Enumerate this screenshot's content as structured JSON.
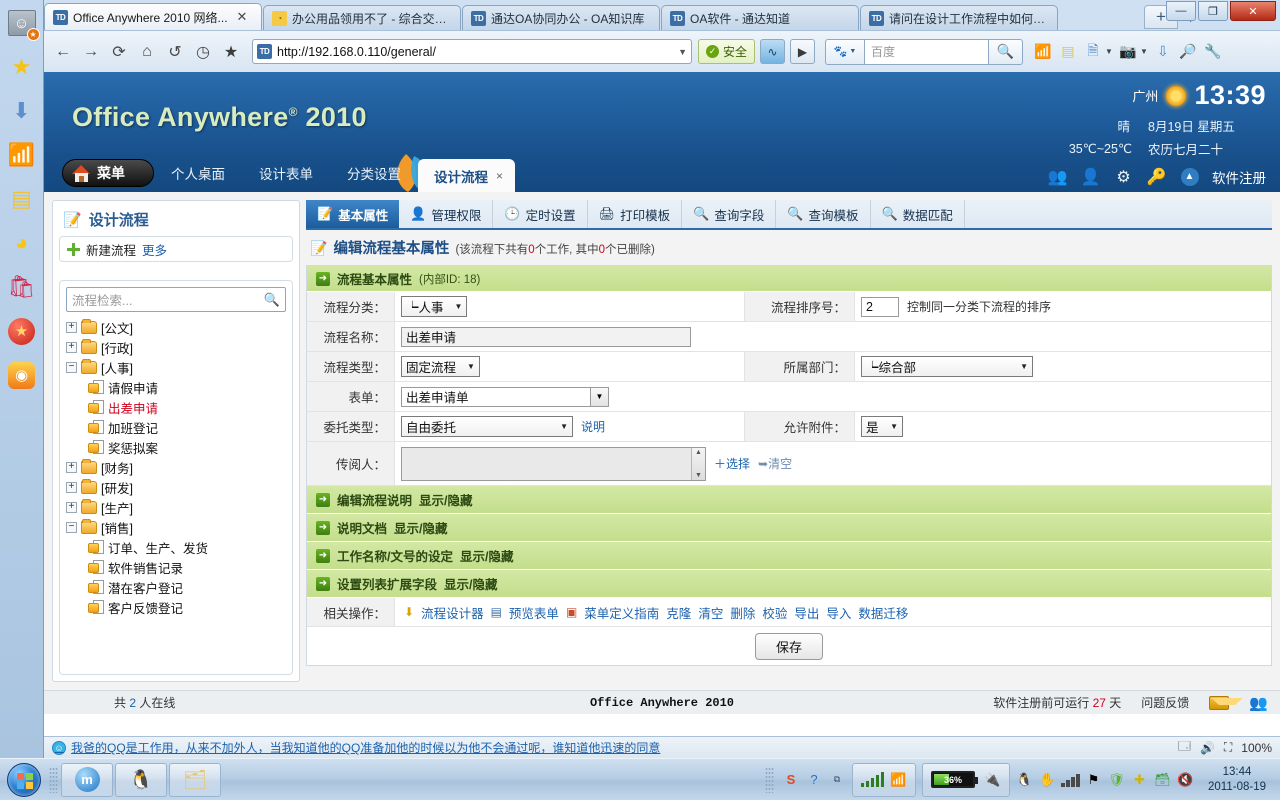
{
  "browser": {
    "tabs": [
      {
        "title": "Office Anywhere 2010 网络...",
        "favicon": "td-icon",
        "active": true,
        "closable": true
      },
      {
        "title": "办公用品领用不了 - 综合交流区...",
        "favicon": "qq-icon",
        "active": false
      },
      {
        "title": "通达OA协同办公 - OA知识库",
        "favicon": "td-icon",
        "active": false
      },
      {
        "title": "OA软件 - 通达知道",
        "favicon": "td-icon",
        "active": false
      },
      {
        "title": "请问在设计工作流程中如何设...",
        "favicon": "td-icon",
        "active": false
      }
    ],
    "newtab_label": "+",
    "window_controls": {
      "minimize": "—",
      "maximize": "❐",
      "close": "✕"
    },
    "nav": {
      "back": "←",
      "forward": "→",
      "reload": "⟳",
      "home": "⌂",
      "undo": "↺",
      "history": "◷",
      "favorite": "★"
    },
    "url": "http://192.168.0.110/general/",
    "url_favicon": "td-icon",
    "secure_label": "安全",
    "search_placeholder": "百度",
    "search_value": "",
    "toolbar_icons": [
      "rss-icon",
      "note-icon",
      "translate-icon",
      "camera-icon",
      "download-icon",
      "screenshot-icon",
      "tools-icon"
    ]
  },
  "rail_icons": [
    "avatar-icon",
    "star-icon",
    "download-arrow-icon",
    "rss-icon",
    "note-icon",
    "pacman-icon",
    "shop-bag-icon",
    "red-star-icon",
    "weibo-icon"
  ],
  "oa": {
    "brand": "Office Anywhere",
    "brand_sup": "®",
    "brand_year": "2010",
    "menu_label": "菜单",
    "nav_tabs": [
      {
        "label": "个人桌面",
        "active": false
      },
      {
        "label": "设计表单",
        "active": false
      },
      {
        "label": "分类设置",
        "active": false
      },
      {
        "label": "设计流程",
        "active": true,
        "close": "×"
      }
    ],
    "header_right": {
      "city": "广州",
      "weather_icon": "sun-icon",
      "clock": "13:39",
      "condition": "晴",
      "date": "8月19日 星期五",
      "temperature": "35℃~25℃",
      "lunar": "农历七月二十",
      "icons": [
        "people-icon",
        "user-edit-icon",
        "gear-icon",
        "key-icon",
        "collapse-icon"
      ],
      "register_link": "软件注册"
    },
    "inline_search_value": ""
  },
  "sidebar": {
    "title": "设计流程",
    "title_icon": "edit-flow-icon",
    "new_flow": "新建流程",
    "more": "更多",
    "search_placeholder": "流程检索...",
    "search_icon": "search-icon",
    "tree": [
      {
        "label": "[公文]",
        "type": "folder",
        "expanded": false,
        "toggle": "+"
      },
      {
        "label": "[行政]",
        "type": "folder",
        "expanded": false,
        "toggle": "+"
      },
      {
        "label": "[人事]",
        "type": "folder",
        "expanded": true,
        "toggle": "−"
      },
      {
        "label": "请假申请",
        "type": "doc",
        "selected": false
      },
      {
        "label": "出差申请",
        "type": "doc",
        "selected": true
      },
      {
        "label": "加班登记",
        "type": "doc",
        "selected": false
      },
      {
        "label": "奖惩拟案",
        "type": "doc",
        "selected": false
      },
      {
        "label": "[财务]",
        "type": "folder",
        "expanded": false,
        "toggle": "+"
      },
      {
        "label": "[研发]",
        "type": "folder",
        "expanded": false,
        "toggle": "+"
      },
      {
        "label": "[生产]",
        "type": "folder",
        "expanded": false,
        "toggle": "+"
      },
      {
        "label": "[销售]",
        "type": "folder",
        "expanded": true,
        "toggle": "−"
      },
      {
        "label": "订单、生产、发货",
        "type": "doc",
        "selected": false
      },
      {
        "label": "软件销售记录",
        "type": "doc",
        "selected": false
      },
      {
        "label": "潜在客户登记",
        "type": "doc",
        "selected": false
      },
      {
        "label": "客户反馈登记",
        "type": "doc",
        "selected": false
      }
    ]
  },
  "main": {
    "tabs": [
      {
        "label": "基本属性",
        "icon": "properties-icon",
        "active": true
      },
      {
        "label": "管理权限",
        "icon": "user-icon",
        "active": false
      },
      {
        "label": "定时设置",
        "icon": "clock-icon",
        "active": false
      },
      {
        "label": "打印模板",
        "icon": "printer-icon",
        "active": false
      },
      {
        "label": "查询字段",
        "icon": "magnifier-icon",
        "active": false
      },
      {
        "label": "查询模板",
        "icon": "magnifier-icon",
        "active": false
      },
      {
        "label": "数据匹配",
        "icon": "magnifier-icon",
        "active": false
      }
    ],
    "page_title": "编辑流程基本属性",
    "page_title_icon": "edit-icon",
    "page_subtitle_pre": "(该流程下共有",
    "page_subtitle_count1": "0",
    "page_subtitle_mid": "个工作, 其中",
    "page_subtitle_count2": "0",
    "page_subtitle_post": "个已删除)",
    "section_basic": "流程基本属性",
    "section_basic_sub": "(内部ID: 18)",
    "fields": {
      "category_label": "流程分类：",
      "category_value": "┕人事",
      "order_label": "流程排序号：",
      "order_value": "2",
      "order_hint": "控制同一分类下流程的排序",
      "name_label": "流程名称：",
      "name_value": "出差申请",
      "type_label": "流程类型：",
      "type_value": "固定流程",
      "dept_label": "所属部门：",
      "dept_value": "┕综合部",
      "form_label": "表单：",
      "form_value": "出差申请单",
      "delegate_label": "委托类型：",
      "delegate_value": "自由委托",
      "delegate_help": "说明",
      "attach_label": "允许附件：",
      "attach_value": "是",
      "cc_label": "传阅人：",
      "cc_value": "",
      "cc_select": "选择",
      "cc_clear": "清空"
    },
    "collapsible_sections": [
      {
        "title": "编辑流程说明",
        "toggle": "显示/隐藏"
      },
      {
        "title": "说明文档",
        "toggle": "显示/隐藏"
      },
      {
        "title": "工作名称/文号的设定",
        "toggle": "显示/隐藏"
      },
      {
        "title": "设置列表扩展字段",
        "toggle": "显示/隐藏"
      }
    ],
    "ops_label": "相关操作：",
    "ops": [
      {
        "label": "流程设计器",
        "icon": "down-arrow-icon"
      },
      {
        "label": "预览表单",
        "icon": "form-icon"
      },
      {
        "label": "菜单定义指南",
        "icon": "guide-icon"
      },
      {
        "label": "克隆"
      },
      {
        "label": "清空"
      },
      {
        "label": "删除"
      },
      {
        "label": "校验"
      },
      {
        "label": "导出"
      },
      {
        "label": "导入"
      },
      {
        "label": "数据迁移"
      }
    ],
    "save_button": "保存"
  },
  "oa_footer": {
    "online_pre": "共",
    "online_count": "2",
    "online_post": "人在线",
    "center": "Office Anywhere 2010",
    "trial_pre": "软件注册前可运行",
    "trial_days": "27",
    "trial_post": "天",
    "feedback": "问题反馈",
    "mail_icon": "envelope-icon",
    "users_icon": "users-icon"
  },
  "statusbar": {
    "text": "我爸的QQ是工作用，从来不加外人，当我知道他的QQ准备加他的时候以为他不会通过呢，谁知道他迅速的同意",
    "zoom": "100%",
    "icons": [
      "window-icon",
      "sound-icon",
      "fullscreen-icon"
    ]
  },
  "taskbar": {
    "start_label": "start-orb",
    "buttons": [
      {
        "icon": "maxthon-icon",
        "name": "maxthon"
      },
      {
        "icon": "qq-penguin-icon",
        "name": "qq"
      },
      {
        "icon": "folder-icon",
        "name": "explorer"
      }
    ],
    "tray_icons": [
      "sogou-icon",
      "help-icon",
      "network-icon",
      "wifi-icon"
    ],
    "battery_percent": "36%",
    "battery_level": 36,
    "notification_icons": [
      "qq-icon",
      "hand-icon",
      "signal-icon",
      "flag-icon",
      "shield-icon",
      "plus-icon",
      "box-icon",
      "mute-icon"
    ],
    "time": "13:44",
    "date": "2011-08-19"
  }
}
